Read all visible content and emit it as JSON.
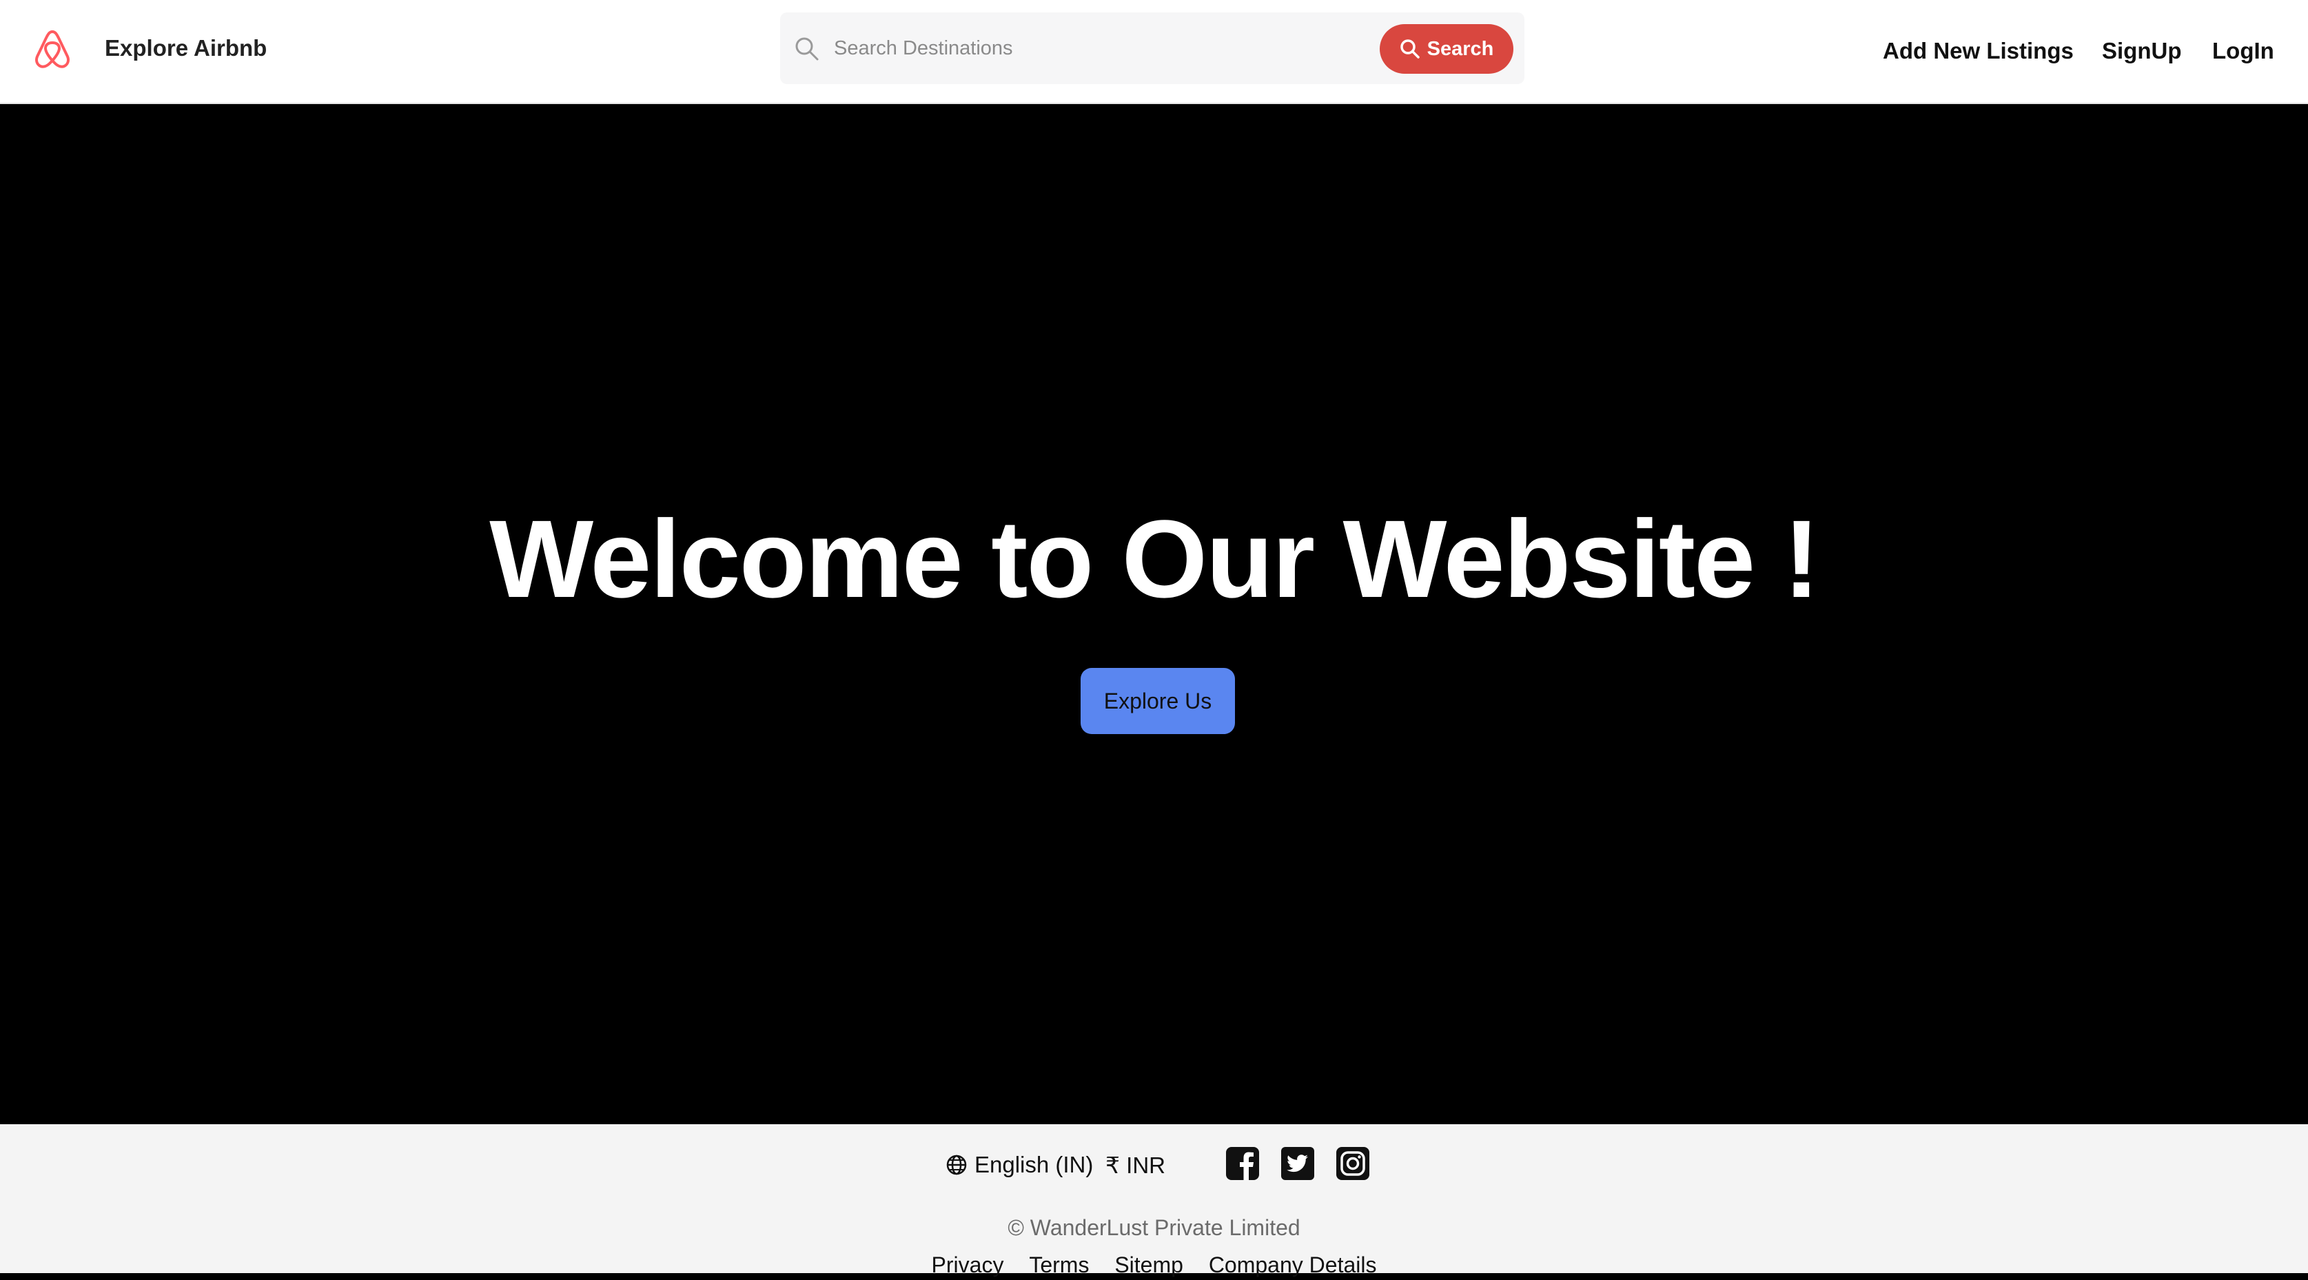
{
  "navbar": {
    "brand": "Explore Airbnb",
    "search": {
      "placeholder": "Search Destinations",
      "button_label": "Search"
    },
    "links": [
      "Add New Listings",
      "SignUp",
      "LogIn"
    ]
  },
  "hero": {
    "title": "Welcome to Our Website !",
    "cta_label": "Explore Us"
  },
  "footer": {
    "language": "English (IN)",
    "currency": "₹ INR",
    "social": [
      "facebook-icon",
      "twitter-icon",
      "instagram-icon"
    ],
    "copyright": "WanderLust Private Limited",
    "links": [
      "Privacy",
      "Terms",
      "Sitemp",
      "Company Details"
    ]
  },
  "colors": {
    "brand": "#ff5a5f",
    "search_button": "#d9473f",
    "cta": "#5a86f0",
    "footer_bg": "#f4f4f4"
  }
}
